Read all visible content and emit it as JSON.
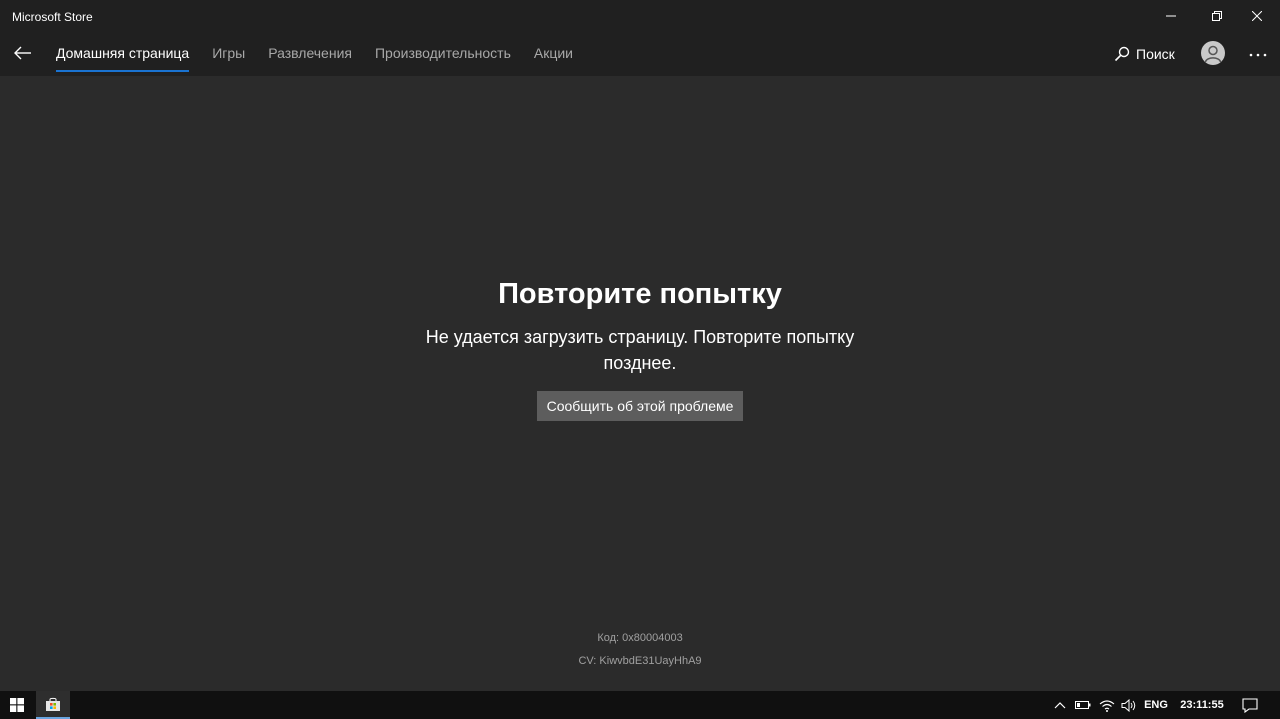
{
  "window": {
    "title": "Microsoft Store",
    "controls": {
      "minimize": "minimize-icon",
      "restore": "restore-icon",
      "close": "close-icon"
    }
  },
  "nav": {
    "back_icon": "back-arrow-icon",
    "tabs": [
      {
        "label": "Домашняя страница",
        "active": true
      },
      {
        "label": "Игры",
        "active": false
      },
      {
        "label": "Развлечения",
        "active": false
      },
      {
        "label": "Производительность",
        "active": false
      },
      {
        "label": "Акции",
        "active": false
      }
    ],
    "search_label": "Поиск",
    "account_icon": "account-icon",
    "more_icon": "more-icon",
    "accent_color": "#1a73d1"
  },
  "error": {
    "title": "Повторите попытку",
    "message": "Не удается загрузить страницу. Повторите попытку позднее.",
    "report_button": "Сообщить об этой проблеме",
    "code": "Код: 0x80004003",
    "cv": "CV: KiwvbdE31UayHhA9"
  },
  "taskbar": {
    "start_icon": "windows-start-icon",
    "pinned_app_icon": "store-bag-icon",
    "language": "ENG",
    "time": "23:11:55"
  }
}
